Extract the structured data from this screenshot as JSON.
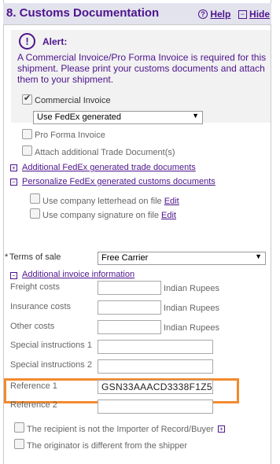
{
  "header": {
    "title": "8. Customs Documentation",
    "help_label": "Help",
    "hide_label": "Hide",
    "help_icon": "help-icon",
    "hide_icon": "minus-icon"
  },
  "alert": {
    "title": "Alert:",
    "message": "A Commercial Invoice/Pro Forma Invoice is required for this shipment. Please print your customs documents and attach them to your shipment."
  },
  "documents": {
    "commercial_invoice": {
      "label": "Commercial Invoice",
      "checked": true
    },
    "commercial_invoice_source": "Use FedEx generated",
    "pro_forma": {
      "label": "Pro Forma Invoice",
      "checked": false
    },
    "attach_additional": {
      "label": "Attach additional Trade Document(s)",
      "checked": false
    },
    "additional_docs_link": "Additional FedEx generated trade documents",
    "personalize_link": "Personalize FedEx generated customs documents",
    "letterhead": {
      "label": "Use company letterhead on file",
      "edit": "Edit",
      "checked": false
    },
    "signature": {
      "label": "Use company signature on file",
      "edit": "Edit",
      "checked": false
    }
  },
  "terms": {
    "required_mark": "*",
    "label": "Terms of sale",
    "value": "Free Carrier"
  },
  "invoice": {
    "toggle_label": "Additional invoice information",
    "freight": {
      "label": "Freight costs",
      "value": "",
      "currency": "Indian Rupees"
    },
    "insurance": {
      "label": "Insurance costs",
      "value": "",
      "currency": "Indian Rupees"
    },
    "other": {
      "label": "Other costs",
      "value": "",
      "currency": "Indian Rupees"
    },
    "special1": {
      "label": "Special instructions 1",
      "value": ""
    },
    "special2": {
      "label": "Special instructions 2",
      "value": ""
    },
    "ref1": {
      "label": "Reference 1",
      "value": "GSN33AAACD3338F1Z5"
    },
    "ref2": {
      "label": "Reference 2",
      "value": ""
    }
  },
  "options": {
    "not_importer": {
      "label": "The recipient is not the Importer of Record/Buyer",
      "checked": false
    },
    "originator_diff": {
      "label": "The originator is different from the shipper",
      "checked": false
    }
  },
  "colors": {
    "accent": "#4d148c",
    "highlight": "#f28a2e"
  }
}
